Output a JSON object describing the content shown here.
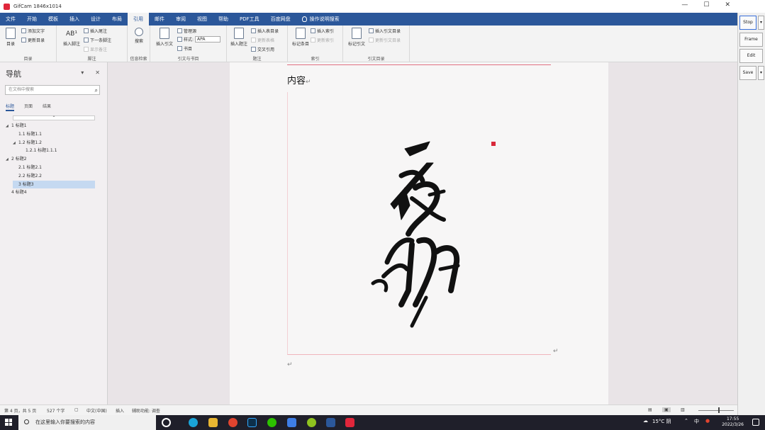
{
  "window": {
    "title": "GifCam 1846x1014",
    "minimize": "—",
    "maximize": "☐",
    "close": "✕"
  },
  "tabs": [
    "文件",
    "开始",
    "模板",
    "插入",
    "设计",
    "布局",
    "引用",
    "邮件",
    "审阅",
    "视图",
    "帮助",
    "PDF工具",
    "百度网盘"
  ],
  "active_tab": "引用",
  "tell_me": "操作说明搜索",
  "ribbon": {
    "toc": {
      "big": "目录",
      "add_text": "添加文字",
      "update_toc": "更新目录",
      "label": "目录"
    },
    "footnotes": {
      "big": "插入脚注",
      "big_icon": "AB¹",
      "insert_endnote": "插入尾注",
      "next_footnote": "下一条脚注",
      "show_notes": "显示备注",
      "label": "脚注"
    },
    "research": {
      "big": "搜索",
      "label": "信息检索"
    },
    "citations": {
      "big": "插入引文",
      "manage": "管理源",
      "style_label": "样式:",
      "style_value": "APA",
      "bibliography": "书目",
      "label": "引文与书目"
    },
    "captions": {
      "big": "插入题注",
      "insert_tof": "插入表目录",
      "update_table": "更新表格",
      "cross_ref": "交叉引用",
      "label": "题注"
    },
    "index": {
      "big": "标记条目",
      "insert_index": "插入索引",
      "update_index": "更新索引",
      "label": "索引"
    },
    "toa": {
      "big": "标记引文",
      "insert_toa": "插入引文目录",
      "update_toa": "更新引文目录",
      "label": "引文目录"
    }
  },
  "gifcam": {
    "stop": "Stop",
    "frame": "Frame",
    "edit": "Edit",
    "save": "Save",
    "dropdown": "▾"
  },
  "nav": {
    "title": "导航",
    "menu": "▾",
    "close": "✕",
    "search_placeholder": "在文档中搜索",
    "search_icon": "⌕",
    "tabs": [
      "标题",
      "页面",
      "结果"
    ],
    "collapse": "⌃",
    "headings": [
      {
        "text": "1 标题1",
        "tri": "◢",
        "level": 0
      },
      {
        "text": "1.1 标题1.1",
        "tri": "",
        "level": 1
      },
      {
        "text": "1.2 标题1.2",
        "tri": "◢",
        "level": 1
      },
      {
        "text": "1.2.1 标题1.1.1",
        "tri": "",
        "level": 2
      },
      {
        "text": "2 标题2",
        "tri": "◢",
        "level": 0
      },
      {
        "text": "2.1 标题2.1",
        "tri": "",
        "level": 1
      },
      {
        "text": "2.2 标题2.2",
        "tri": "",
        "level": 1
      },
      {
        "text": "3 标题3",
        "tri": "",
        "level": 0,
        "selected": true
      },
      {
        "text": "4 标题4",
        "tri": "",
        "level": 0
      }
    ]
  },
  "document": {
    "content_text": "内容",
    "paragraph_mark": "↵"
  },
  "status": {
    "page": "第 4 页，共 5 页",
    "words": "527 个字",
    "language": "中文(中国)",
    "mode": "插入",
    "accessibility": "辅助功能: 调查"
  },
  "taskbar": {
    "search_placeholder": "在这里输入你要搜索的内容",
    "weather": "15°C 阴",
    "ime": "中",
    "time": "17:55",
    "date": "2022/3/26"
  },
  "colors": {
    "ribbon_blue": "#2b579a",
    "selection": "#c5d9f1",
    "gifcam_app": "#e0263b"
  }
}
